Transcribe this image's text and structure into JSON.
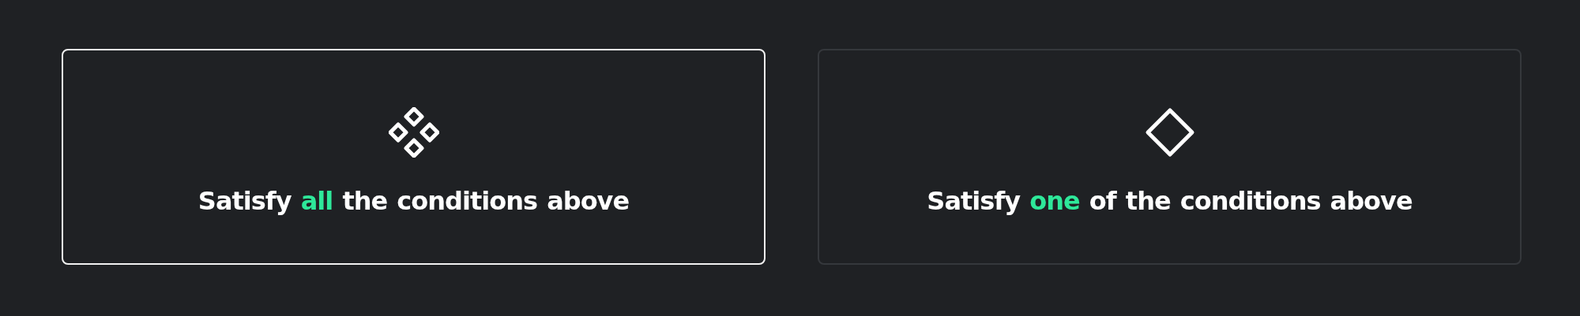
{
  "options": [
    {
      "kind": "all",
      "before": "Satisfy",
      "highlight": "all",
      "after": "the conditions above",
      "selected": true
    },
    {
      "kind": "any",
      "before": "Satisfy",
      "highlight": "one",
      "after": "of the conditions above",
      "selected": false
    }
  ]
}
